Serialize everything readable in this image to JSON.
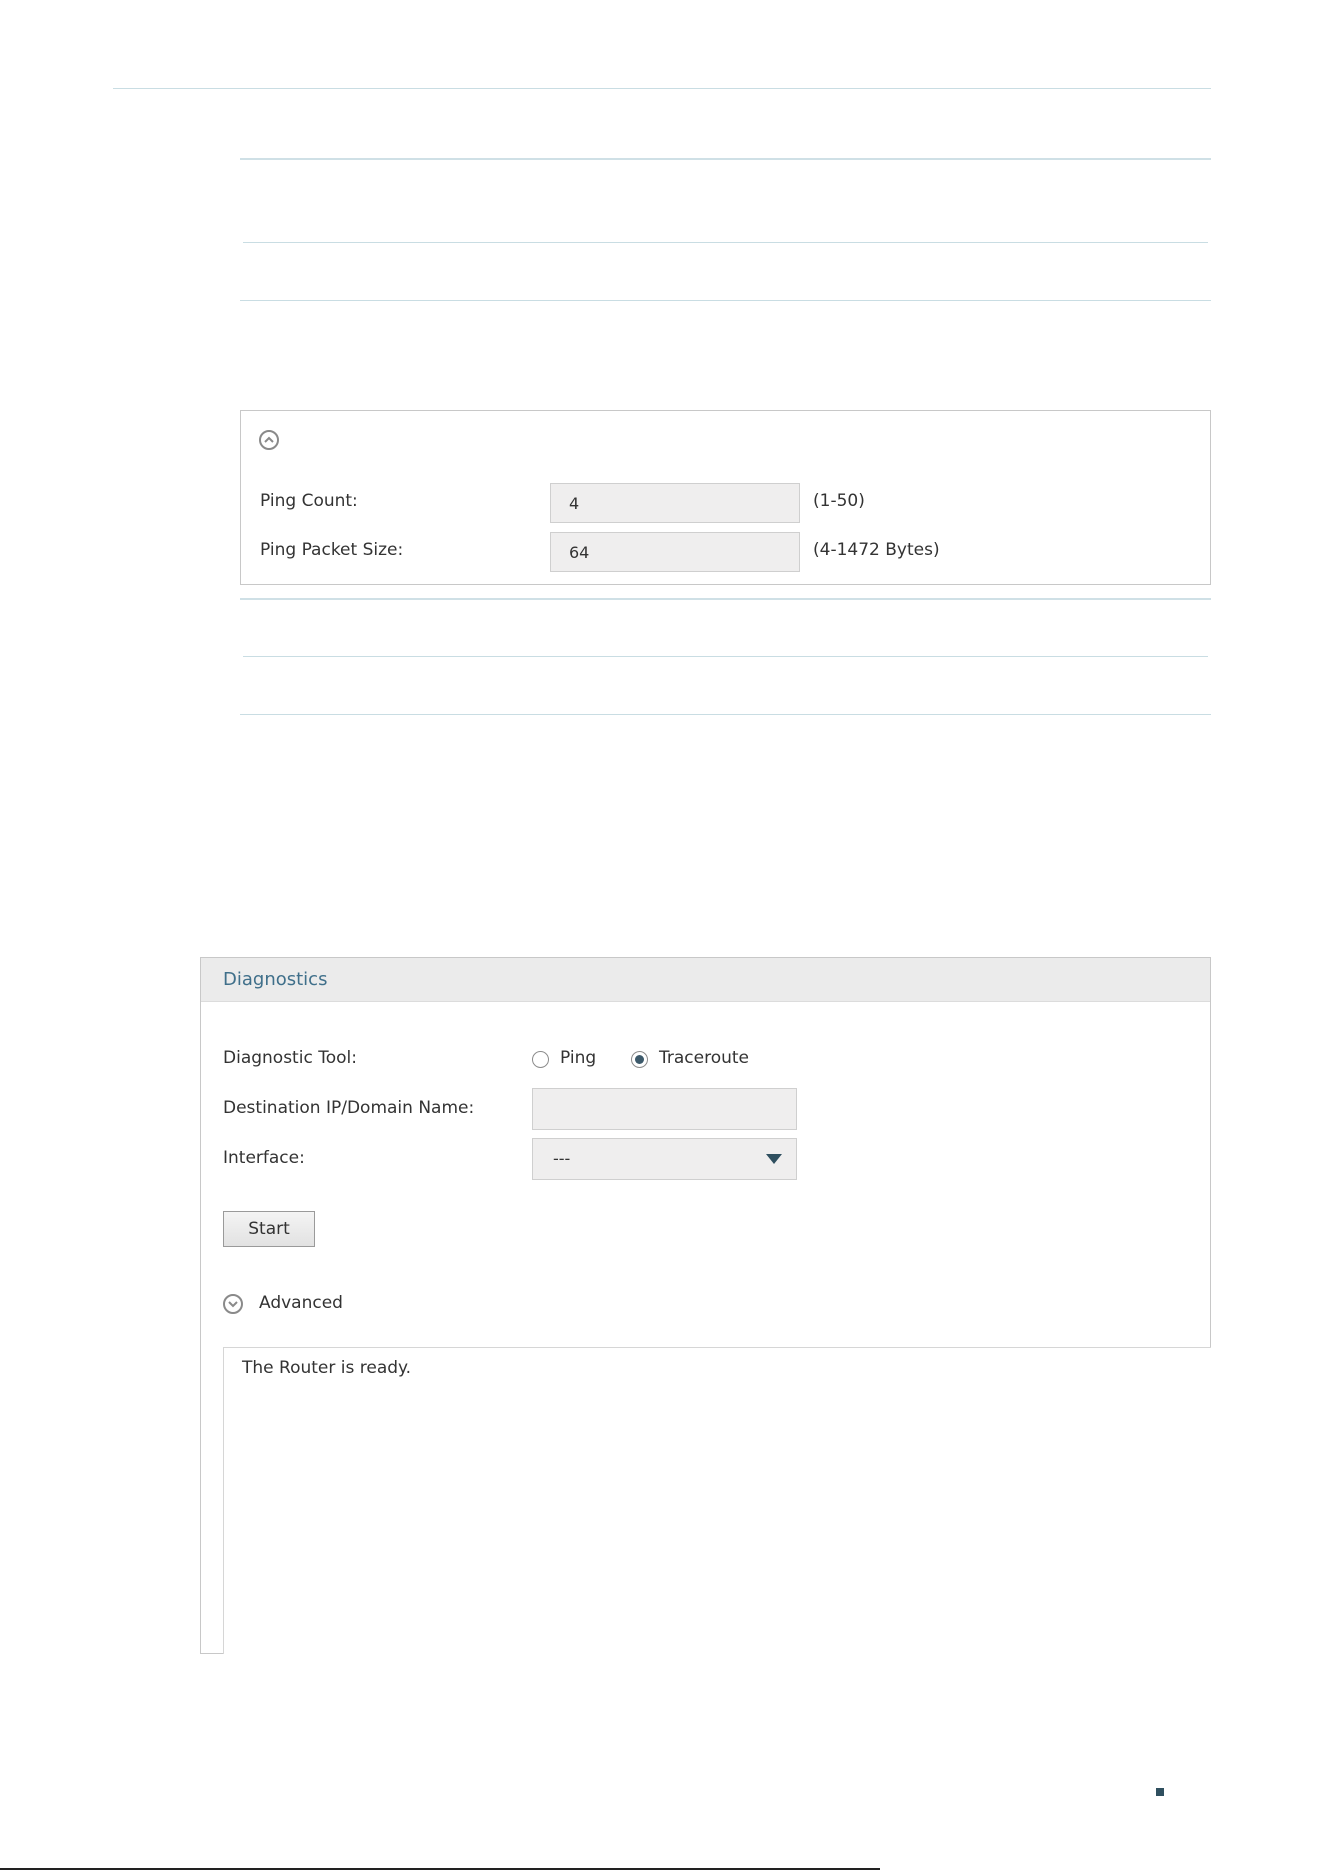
{
  "advanced_panel": {
    "ping_count_label": "Ping Count:",
    "ping_count_value": "4",
    "ping_count_hint": "(1-50)",
    "ping_packet_size_label": "Ping Packet Size:",
    "ping_packet_size_value": "64",
    "ping_packet_size_hint": "(4-1472 Bytes)",
    "collapse_icon": "chevron-up-circle-icon"
  },
  "diagnostics": {
    "title": "Diagnostics",
    "tool_label": "Diagnostic Tool:",
    "tool_options": [
      {
        "label": "Ping",
        "selected": false
      },
      {
        "label": "Traceroute",
        "selected": true
      }
    ],
    "destination_label": "Destination IP/Domain Name:",
    "destination_value": "",
    "interface_label": "Interface:",
    "interface_value": "---",
    "start_button": "Start",
    "advanced_label": "Advanced",
    "advanced_icon": "chevron-down-circle-icon",
    "output_text": "The Router is ready."
  },
  "colors": {
    "header_bg": "#ebebeb",
    "title_color": "#3f6f8a",
    "field_bg": "#efeeee",
    "radio_dot": "#3d5a6b",
    "caret": "#2f4f5f",
    "divider": "#c9dde3"
  }
}
